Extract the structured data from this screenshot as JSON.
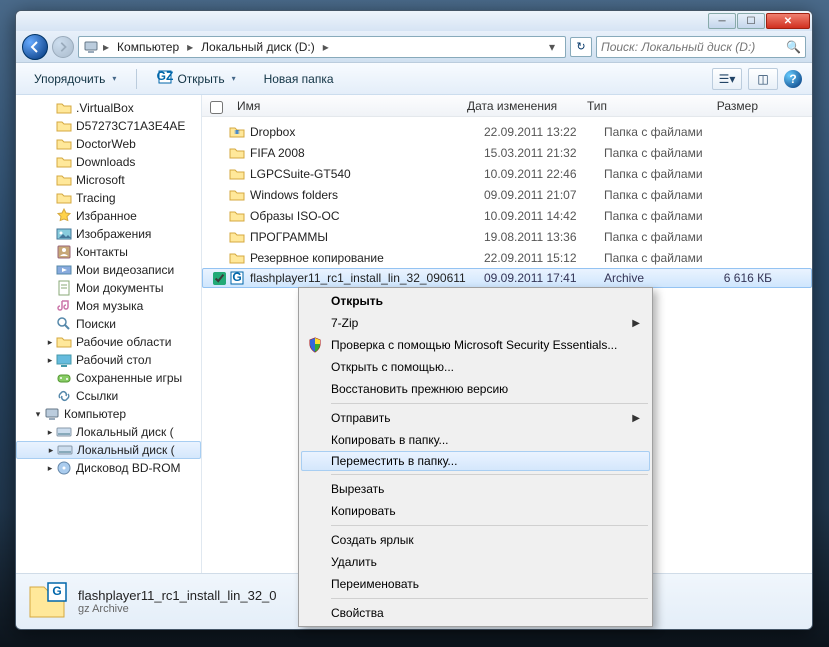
{
  "breadcrumb": {
    "seg1": "Компьютер",
    "seg2": "Локальный диск (D:)"
  },
  "search": {
    "placeholder": "Поиск: Локальный диск (D:)"
  },
  "toolbar": {
    "organize": "Упорядочить",
    "open": "Открыть",
    "newfolder": "Новая папка"
  },
  "columns": {
    "name": "Имя",
    "date": "Дата изменения",
    "type": "Тип",
    "size": "Размер"
  },
  "sidebar": {
    "items": [
      {
        "label": ".VirtualBox",
        "icon": "folder",
        "lvl": 1
      },
      {
        "label": "D57273C71A3E4AE",
        "icon": "folder",
        "lvl": 1
      },
      {
        "label": "DoctorWeb",
        "icon": "folder",
        "lvl": 1
      },
      {
        "label": "Downloads",
        "icon": "folder",
        "lvl": 1
      },
      {
        "label": "Microsoft",
        "icon": "folder",
        "lvl": 1
      },
      {
        "label": "Tracing",
        "icon": "folder",
        "lvl": 1
      },
      {
        "label": "Избранное",
        "icon": "star",
        "lvl": 1
      },
      {
        "label": "Изображения",
        "icon": "pictures",
        "lvl": 1
      },
      {
        "label": "Контакты",
        "icon": "contacts",
        "lvl": 1
      },
      {
        "label": "Мои видеозаписи",
        "icon": "videos",
        "lvl": 1
      },
      {
        "label": "Мои документы",
        "icon": "documents",
        "lvl": 1
      },
      {
        "label": "Моя музыка",
        "icon": "music",
        "lvl": 1
      },
      {
        "label": "Поиски",
        "icon": "searches",
        "lvl": 1
      },
      {
        "label": "Рабочие области",
        "icon": "folder",
        "lvl": 1,
        "exp": true
      },
      {
        "label": "Рабочий стол",
        "icon": "desktop",
        "lvl": 1,
        "exp": true
      },
      {
        "label": "Сохраненные игры",
        "icon": "games",
        "lvl": 1
      },
      {
        "label": "Ссылки",
        "icon": "links",
        "lvl": 1
      },
      {
        "label": "Компьютер",
        "icon": "computer",
        "lvl": 0,
        "exp": true,
        "open": true
      },
      {
        "label": "Локальный диск (",
        "icon": "disk",
        "lvl": 1,
        "exp": true
      },
      {
        "label": "Локальный диск (",
        "icon": "disk",
        "lvl": 1,
        "exp": true,
        "sel": true
      },
      {
        "label": "Дисковод BD-ROM",
        "icon": "bd",
        "lvl": 1,
        "exp": true
      }
    ]
  },
  "files": [
    {
      "name": "Dropbox",
      "date": "22.09.2011 13:22",
      "type": "Папка с файлами",
      "icon": "dropbox"
    },
    {
      "name": "FIFA 2008",
      "date": "15.03.2011 21:32",
      "type": "Папка с файлами",
      "icon": "folder"
    },
    {
      "name": "LGPCSuite-GT540",
      "date": "10.09.2011 22:46",
      "type": "Папка с файлами",
      "icon": "folder"
    },
    {
      "name": "Windows folders",
      "date": "09.09.2011 21:07",
      "type": "Папка с файлами",
      "icon": "folder"
    },
    {
      "name": "Образы ISO-OC",
      "date": "10.09.2011 14:42",
      "type": "Папка с файлами",
      "icon": "folder"
    },
    {
      "name": "ПРОГРАММЫ",
      "date": "19.08.2011 13:36",
      "type": "Папка с файлами",
      "icon": "folder"
    },
    {
      "name": "Резервное копирование",
      "date": "22.09.2011 15:12",
      "type": "Папка с файлами",
      "icon": "folder"
    },
    {
      "name": "flashplayer11_rc1_install_lin_32_090611",
      "date": "09.09.2011 17:41",
      "type": "Archive",
      "size": "6 616 КБ",
      "icon": "gz",
      "selected": true
    }
  ],
  "status": {
    "title": "flashplayer11_rc1_install_lin_32_0",
    "sub": "gz Archive"
  },
  "context": [
    {
      "label": "Открыть",
      "bold": true
    },
    {
      "label": "7-Zip",
      "sub": true
    },
    {
      "label": "Проверка с помощью Microsoft Security Essentials...",
      "icon": "shield"
    },
    {
      "label": "Открыть с помощью..."
    },
    {
      "label": "Восстановить прежнюю версию"
    },
    {
      "sep": true
    },
    {
      "label": "Отправить",
      "sub": true
    },
    {
      "label": "Копировать в папку..."
    },
    {
      "label": "Переместить в папку...",
      "hover": true
    },
    {
      "sep": true
    },
    {
      "label": "Вырезать"
    },
    {
      "label": "Копировать"
    },
    {
      "sep": true
    },
    {
      "label": "Создать ярлык"
    },
    {
      "label": "Удалить"
    },
    {
      "label": "Переименовать"
    },
    {
      "sep": true
    },
    {
      "label": "Свойства"
    }
  ]
}
